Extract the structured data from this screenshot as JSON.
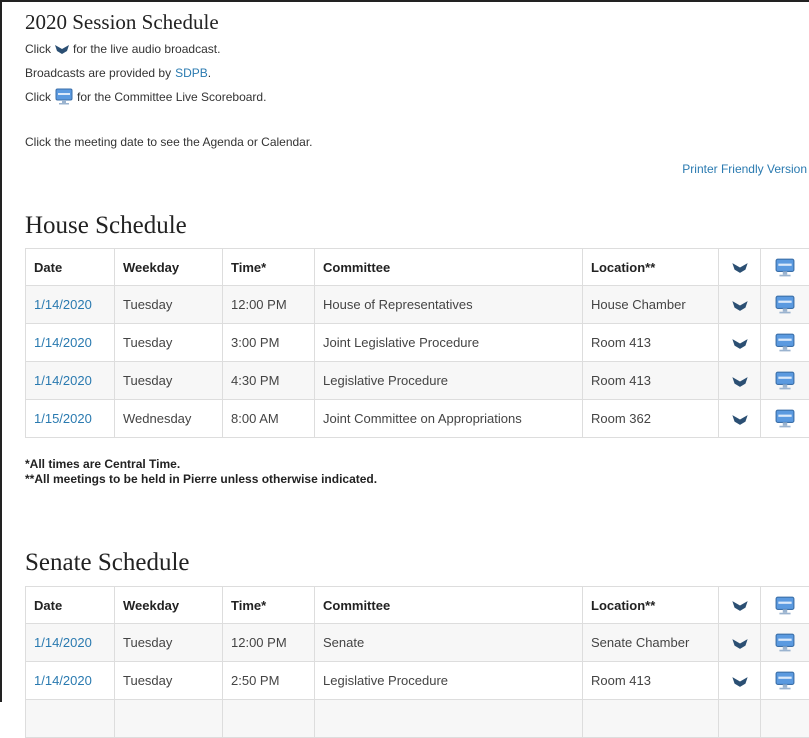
{
  "page": {
    "title": "2020 Session Schedule",
    "intro_click_1": "Click",
    "intro_audio_rest": "for the live audio broadcast.",
    "broadcast_prefix": "Broadcasts are provided by",
    "broadcast_link": "SDPB",
    "broadcast_suffix": ".",
    "intro_click_2": "Click",
    "intro_scoreboard_rest": "for the Committee Live Scoreboard.",
    "meeting_hint": "Click the meeting date to see the Agenda or Calendar.",
    "printer_link": "Printer Friendly Version"
  },
  "columns": {
    "date": "Date",
    "weekday": "Weekday",
    "time": "Time*",
    "committee": "Committee",
    "location": "Location**"
  },
  "house": {
    "title": "House Schedule",
    "rows": [
      {
        "date": "1/14/2020",
        "weekday": "Tuesday",
        "time": "12:00 PM",
        "committee": "House of Representatives",
        "location": "House Chamber"
      },
      {
        "date": "1/14/2020",
        "weekday": "Tuesday",
        "time": "3:00 PM",
        "committee": "Joint Legislative Procedure",
        "location": "Room 413"
      },
      {
        "date": "1/14/2020",
        "weekday": "Tuesday",
        "time": "4:30 PM",
        "committee": "Legislative Procedure",
        "location": "Room 413"
      },
      {
        "date": "1/15/2020",
        "weekday": "Wednesday",
        "time": "8:00 AM",
        "committee": "Joint Committee on Appropriations",
        "location": "Room 362"
      }
    ]
  },
  "notes": {
    "central_time": "*All times are Central Time.",
    "pierre": "**All meetings to be held in Pierre unless otherwise indicated."
  },
  "senate": {
    "title": "Senate Schedule",
    "rows": [
      {
        "date": "1/14/2020",
        "weekday": "Tuesday",
        "time": "12:00 PM",
        "committee": "Senate",
        "location": "Senate Chamber"
      },
      {
        "date": "1/14/2020",
        "weekday": "Tuesday",
        "time": "2:50 PM",
        "committee": "Legislative Procedure",
        "location": "Room 413"
      },
      {
        "date": "",
        "weekday": "",
        "time": "",
        "committee": "",
        "location": ""
      }
    ]
  },
  "icons": {
    "audio": "audio-broadcast-icon",
    "scoreboard": "scoreboard-monitor-icon",
    "audio_color": "#2b4f73",
    "scoreboard_color": "#4a8fd8"
  }
}
